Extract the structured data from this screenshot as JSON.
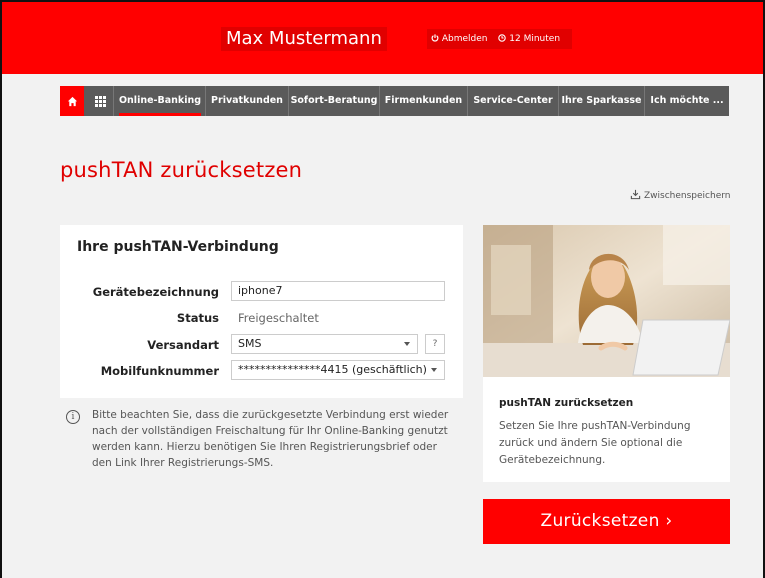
{
  "header": {
    "user_name": "Max Mustermann",
    "logout_label": "Abmelden",
    "session_timer": "12 Minuten",
    "power_icon": "power-icon",
    "clock_icon": "clock-icon"
  },
  "nav": {
    "home_icon": "home-icon",
    "grid_icon": "grid-icon",
    "items": [
      {
        "label": "Online-Banking"
      },
      {
        "label": "Privatkunden"
      },
      {
        "label": "Sofort-Beratung"
      },
      {
        "label": "Firmenkunden"
      },
      {
        "label": "Service-Center"
      },
      {
        "label": "Ihre Sparkasse"
      },
      {
        "label": "Ich möchte ..."
      }
    ],
    "active": "Online-Banking"
  },
  "page": {
    "title": "pushTAN zurücksetzen",
    "save_label": "Zwischenspeichern"
  },
  "form": {
    "title": "Ihre pushTAN-Verbindung",
    "device_label": "Gerätebezeichnung",
    "device_value": "iphone7",
    "status_label": "Status",
    "status_value": "Freigeschaltet",
    "shipping_label": "Versandart",
    "shipping_value": "SMS",
    "help_label": "?",
    "mobile_label": "Mobilfunknummer",
    "mobile_value": "***************4415 (geschäftlich)"
  },
  "info": {
    "icon": "info-icon",
    "text": "Bitte beachten Sie, dass die zurückgesetzte Verbindung erst wieder nach der vollständigen Freischaltung für Ihr Online-Banking genutzt werden kann. Hierzu benötigen Sie Ihren Registrierungsbrief oder den Link Ihrer Registrierungs-SMS."
  },
  "teaser": {
    "title": "pushTAN zurücksetzen",
    "description": "Setzen Sie Ihre pushTAN-Verbindung zurück und ändern Sie optional die Gerätebezeichnung."
  },
  "cta": {
    "label": "Zurücksetzen ›"
  },
  "colors": {
    "brand_red": "#ff0000",
    "nav_gray": "#5a5a5a"
  }
}
